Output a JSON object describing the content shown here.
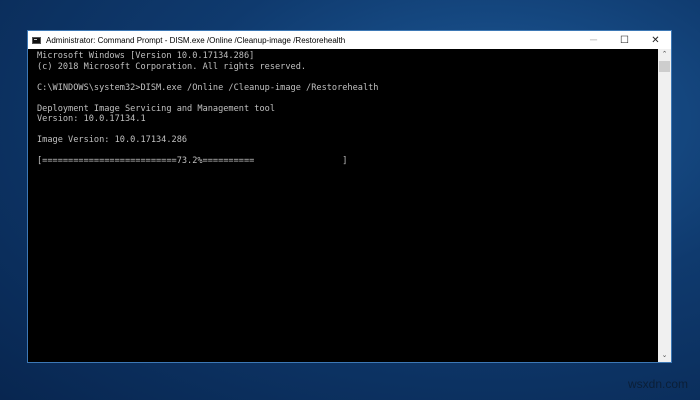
{
  "window": {
    "title": "Administrator: Command Prompt - DISM.exe  /Online /Cleanup-image /Restorehealth",
    "minimize": "─",
    "maximize": "☐",
    "close": "✕"
  },
  "console": {
    "lines": [
      "Microsoft Windows [Version 10.0.17134.286]",
      "(c) 2018 Microsoft Corporation. All rights reserved.",
      "",
      "C:\\WINDOWS\\system32>DISM.exe /Online /Cleanup-image /Restorehealth",
      "",
      "Deployment Image Servicing and Management tool",
      "Version: 10.0.17134.1",
      "",
      "Image Version: 10.0.17134.286",
      "",
      "[==========================73.2%==========                 ]"
    ],
    "progress_percent": 73.2
  },
  "scrollbar": {
    "up": "⌃",
    "down": "⌄"
  },
  "watermark": "wsxdn.com"
}
